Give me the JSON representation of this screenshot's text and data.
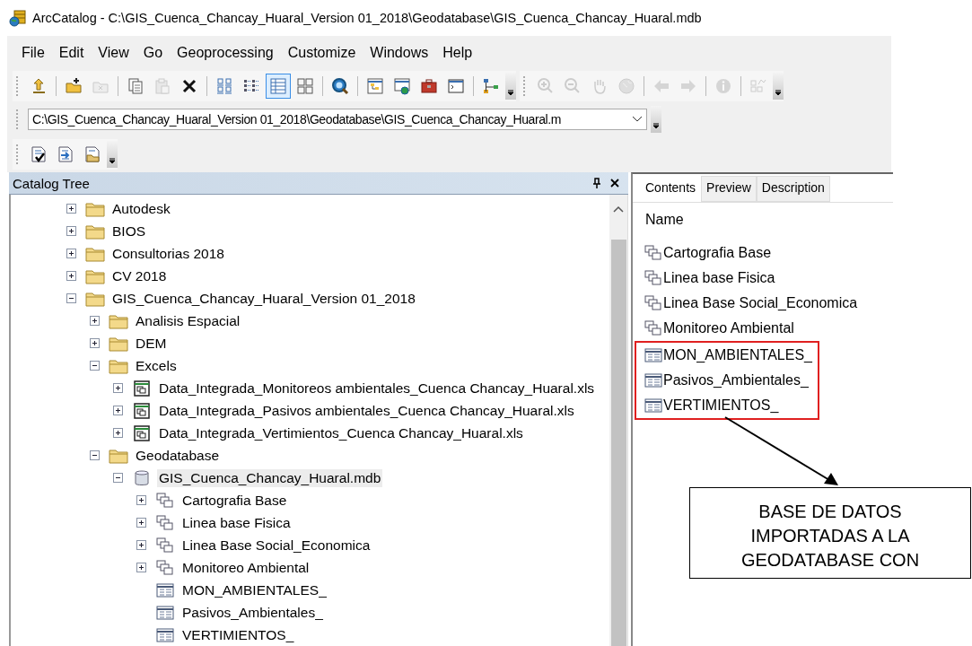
{
  "window": {
    "title": "ArcCatalog - C:\\GIS_Cuenca_Chancay_Huaral_Version 01_2018\\Geodatabase\\GIS_Cuenca_Chancay_Huaral.mdb"
  },
  "menu": [
    "File",
    "Edit",
    "View",
    "Go",
    "Geoprocessing",
    "Customize",
    "Windows",
    "Help"
  ],
  "toolbar": {
    "groups": [
      [
        {
          "kind": "up",
          "disabled": false,
          "selected": false
        }
      ],
      [
        {
          "kind": "connect",
          "disabled": false,
          "selected": false
        },
        {
          "kind": "disconnect",
          "disabled": true,
          "selected": false
        }
      ],
      [
        {
          "kind": "copy",
          "disabled": false,
          "selected": false
        },
        {
          "kind": "paste",
          "disabled": true,
          "selected": false
        },
        {
          "kind": "delete",
          "disabled": false,
          "selected": false
        }
      ],
      [
        {
          "kind": "large",
          "disabled": false,
          "selected": false
        },
        {
          "kind": "list",
          "disabled": false,
          "selected": false
        },
        {
          "kind": "details",
          "disabled": false,
          "selected": true
        },
        {
          "kind": "thumbs",
          "disabled": false,
          "selected": false
        }
      ],
      [
        {
          "kind": "search",
          "disabled": false,
          "selected": false
        }
      ],
      [
        {
          "kind": "treewin",
          "disabled": false,
          "selected": false
        },
        {
          "kind": "searchwin",
          "disabled": false,
          "selected": false
        },
        {
          "kind": "toolbox",
          "disabled": false,
          "selected": false
        },
        {
          "kind": "python",
          "disabled": false,
          "selected": false
        }
      ],
      [
        {
          "kind": "model",
          "disabled": false,
          "selected": false
        }
      ]
    ],
    "geo_groups": [
      [
        {
          "kind": "zoomin",
          "disabled": true,
          "selected": false
        },
        {
          "kind": "zoomout",
          "disabled": true,
          "selected": false
        },
        {
          "kind": "pan",
          "disabled": true,
          "selected": false
        },
        {
          "kind": "globe",
          "disabled": true,
          "selected": false
        }
      ],
      [
        {
          "kind": "back",
          "disabled": true,
          "selected": false
        },
        {
          "kind": "forward",
          "disabled": true,
          "selected": false
        }
      ],
      [
        {
          "kind": "info",
          "disabled": true,
          "selected": false
        }
      ],
      [
        {
          "kind": "layout",
          "disabled": true,
          "selected": false
        }
      ]
    ]
  },
  "location": {
    "value": "C:\\GIS_Cuenca_Chancay_Huaral_Version 01_2018\\Geodatabase\\GIS_Cuenca_Chancay_Huaral.m"
  },
  "catalog_tree": {
    "title": "Catalog Tree",
    "items": [
      {
        "kind": "folder",
        "label": "Autodesk",
        "expanded": false,
        "selected": false
      },
      {
        "kind": "folder",
        "label": "BIOS",
        "expanded": false,
        "selected": false
      },
      {
        "kind": "folder",
        "label": "Consultorias 2018",
        "expanded": false,
        "selected": false
      },
      {
        "kind": "folder",
        "label": "CV 2018",
        "expanded": false,
        "selected": false
      },
      {
        "kind": "folder",
        "label": "GIS_Cuenca_Chancay_Huaral_Version 01_2018",
        "expanded": true,
        "selected": false,
        "children": [
          {
            "kind": "folder",
            "label": "Analisis Espacial",
            "expanded": false,
            "selected": false
          },
          {
            "kind": "folder",
            "label": "DEM",
            "expanded": false,
            "selected": false
          },
          {
            "kind": "folder",
            "label": "Excels",
            "expanded": true,
            "selected": false,
            "children": [
              {
                "kind": "excel",
                "label": "Data_Integrada_Monitoreos ambientales_Cuenca Chancay_Huaral.xls",
                "expanded": false,
                "selected": false
              },
              {
                "kind": "excel",
                "label": "Data_Integrada_Pasivos ambientales_Cuenca Chancay_Huaral.xls",
                "expanded": false,
                "selected": false
              },
              {
                "kind": "excel",
                "label": "Data_Integrada_Vertimientos_Cuenca Chancay_Huaral.xls",
                "expanded": false,
                "selected": false
              }
            ]
          },
          {
            "kind": "folder",
            "label": "Geodatabase",
            "expanded": true,
            "selected": false,
            "children": [
              {
                "kind": "database",
                "label": "GIS_Cuenca_Chancay_Huaral.mdb",
                "expanded": true,
                "selected": true,
                "children": [
                  {
                    "kind": "dataset",
                    "label": "Cartografia Base",
                    "expanded": false,
                    "selected": false
                  },
                  {
                    "kind": "dataset",
                    "label": "Linea base Fisica",
                    "expanded": false,
                    "selected": false
                  },
                  {
                    "kind": "dataset",
                    "label": "Linea Base Social_Economica",
                    "expanded": false,
                    "selected": false
                  },
                  {
                    "kind": "dataset",
                    "label": "Monitoreo Ambiental",
                    "expanded": false,
                    "selected": false
                  },
                  {
                    "kind": "table",
                    "label": "MON_AMBIENTALES_",
                    "selected": false
                  },
                  {
                    "kind": "table",
                    "label": "Pasivos_Ambientales_",
                    "selected": false
                  },
                  {
                    "kind": "table",
                    "label": "VERTIMIENTOS_",
                    "selected": false
                  }
                ]
              }
            ]
          }
        ]
      }
    ]
  },
  "contents": {
    "tabs": [
      {
        "label": "Contents",
        "selected": true
      },
      {
        "label": "Preview",
        "selected": false
      },
      {
        "label": "Description",
        "selected": false
      }
    ],
    "column": "Name",
    "items": [
      {
        "kind": "dataset",
        "label": "Cartografia Base"
      },
      {
        "kind": "dataset",
        "label": "Linea base Fisica"
      },
      {
        "kind": "dataset",
        "label": "Linea Base Social_Economica"
      },
      {
        "kind": "dataset",
        "label": "Monitoreo Ambiental"
      }
    ],
    "highlighted_items": [
      {
        "kind": "table",
        "label": "MON_AMBIENTALES_"
      },
      {
        "kind": "table",
        "label": "Pasivos_Ambientales_"
      },
      {
        "kind": "table",
        "label": "VERTIMIENTOS_"
      }
    ]
  },
  "callout": {
    "lines": [
      "BASE DE DATOS",
      "IMPORTADAS A LA",
      "GEODATABASE CON"
    ]
  }
}
